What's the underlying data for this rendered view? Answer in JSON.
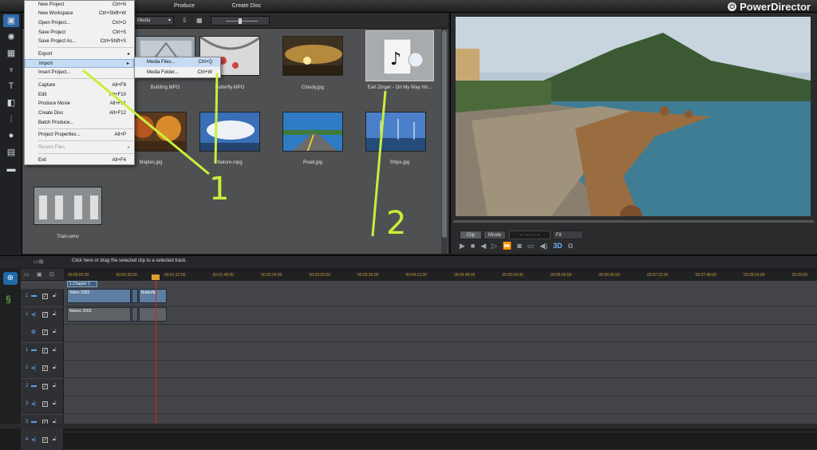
{
  "app": {
    "brand": "PowerDirector"
  },
  "tabs": [
    {
      "label": "Produce"
    },
    {
      "label": "Create Disc"
    }
  ],
  "library": {
    "filter": "Media",
    "items": [
      {
        "name": "Building.MPO"
      },
      {
        "name": "Butterfly.MPO"
      },
      {
        "name": "Cloudy.jpg"
      },
      {
        "name": "Earl Zinger - On My Way Ho..."
      },
      {
        "name": "Maples.jpg"
      },
      {
        "name": "Nature.mpg"
      },
      {
        "name": "Road.jpg"
      },
      {
        "name": "Ships.jpg"
      },
      {
        "name": "Tram.wmv"
      }
    ]
  },
  "menu": {
    "items": [
      {
        "label": "New Project",
        "shortcut": "Ctrl+N"
      },
      {
        "label": "New Workspace",
        "shortcut": "Ctrl+Shift+W"
      },
      {
        "label": "Open Project...",
        "shortcut": "Ctrl+O"
      },
      {
        "label": "Save Project",
        "shortcut": "Ctrl+S"
      },
      {
        "label": "Save Project As...",
        "shortcut": "Ctrl+Shift+S"
      },
      {
        "label": "Export",
        "shortcut": ""
      },
      {
        "label": "Import",
        "shortcut": ""
      },
      {
        "label": "Insert Project...",
        "shortcut": ""
      },
      {
        "label": "Capture",
        "shortcut": "Alt+F9"
      },
      {
        "label": "Edit",
        "shortcut": "Alt+F10"
      },
      {
        "label": "Produce Movie",
        "shortcut": "Alt+F11"
      },
      {
        "label": "Create Disc",
        "shortcut": "Alt+F12"
      },
      {
        "label": "Batch Produce...",
        "shortcut": ""
      },
      {
        "label": "Project Properties...",
        "shortcut": "Alt+P"
      },
      {
        "label": "Recent Files",
        "shortcut": ""
      },
      {
        "label": "Exit",
        "shortcut": "Alt+F4"
      }
    ],
    "submenu": [
      {
        "label": "Media Files...",
        "shortcut": "Ctrl+Q"
      },
      {
        "label": "Media Folder...",
        "shortcut": "Ctrl+W"
      }
    ]
  },
  "preview": {
    "clip_tab": "Clip",
    "movie_tab": "Movie",
    "timecode": "-- : -- : -- : --",
    "zoom": "Fit"
  },
  "timeline": {
    "hint": "Click here or drag the selected clip to a selected track.",
    "chapter": "1.Chapter 1",
    "ruler": [
      "00:00:00:00",
      "00:00:36:00",
      "00:01:12:00",
      "00:01:48:00",
      "00:02:24:00",
      "00:03:00:00",
      "00:03:36:00",
      "00:04:12:00",
      "00:04:48:00",
      "00:05:24:00",
      "00:06:00:00",
      "00:06:36:00",
      "00:07:12:00",
      "00:07:48:00",
      "00:08:24:00",
      "00:09:00"
    ],
    "track_numbers": [
      "1",
      "1",
      "",
      "1",
      "2",
      "2",
      "3",
      "3",
      "4",
      "4"
    ],
    "clips": {
      "video1": "Video 2003",
      "audio1": "Nature 2003",
      "b": "Butterfly"
    }
  },
  "annotations": {
    "one": "1",
    "two": "2"
  },
  "colors": {
    "accent_line": "#c8ef3a",
    "playhead": "#dd2222",
    "ruler_text": "#c49a3c"
  }
}
